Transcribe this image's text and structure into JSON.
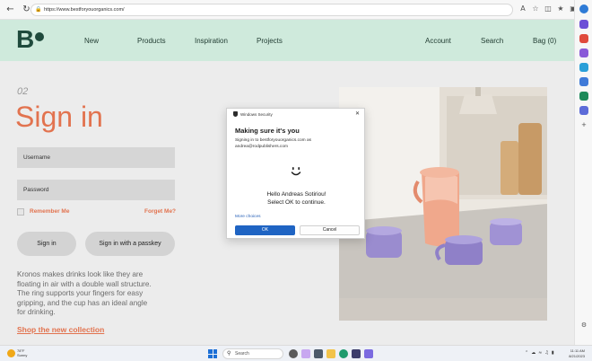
{
  "browser": {
    "url": "https://www.bestforyouorganics.com/",
    "back_icon": "back-arrow-icon",
    "refresh_icon": "refresh-icon"
  },
  "site": {
    "logo_letter": "B",
    "nav_left": [
      "New",
      "Products",
      "Inspiration",
      "Projects"
    ],
    "nav_right": [
      "Account",
      "Search",
      "Bag (0)"
    ],
    "step_number": "02",
    "title": "Sign in",
    "username_placeholder": "Username",
    "password_placeholder": "Password",
    "remember_label": "Remember Me",
    "forget_label": "Forget Me?",
    "sign_in_label": "Sign in",
    "passkey_label": "Sign in with a passkey",
    "description_lines": [
      "Kronos makes drinks look like they are",
      "floating in air with a double wall structure.",
      "The ring supports your fingers for easy",
      "gripping, and the cup has an ideal angle",
      "for drinking."
    ],
    "shop_link": "Shop the new collection",
    "colors": {
      "accent": "#e2734f",
      "header_bg": "#cfeadc",
      "brand_dark": "#1f4a3c"
    }
  },
  "dialog": {
    "window_title": "Windows Security",
    "heading": "Making sure it's you",
    "body_line1": "Signing in to bestforyouorganics.com as",
    "body_line2": "andrea@rodpublishers.com",
    "hello_line1": "Hello Andreas Sotiriou!",
    "hello_line2": "Select OK to continue.",
    "more_choices": "More choices",
    "ok_label": "OK",
    "cancel_label": "Cancel"
  },
  "taskbar": {
    "weather_temp": "78°F",
    "weather_desc": "Sunny",
    "search_placeholder": "Search",
    "time": "11:11 AM",
    "date": "8/21/2023"
  }
}
